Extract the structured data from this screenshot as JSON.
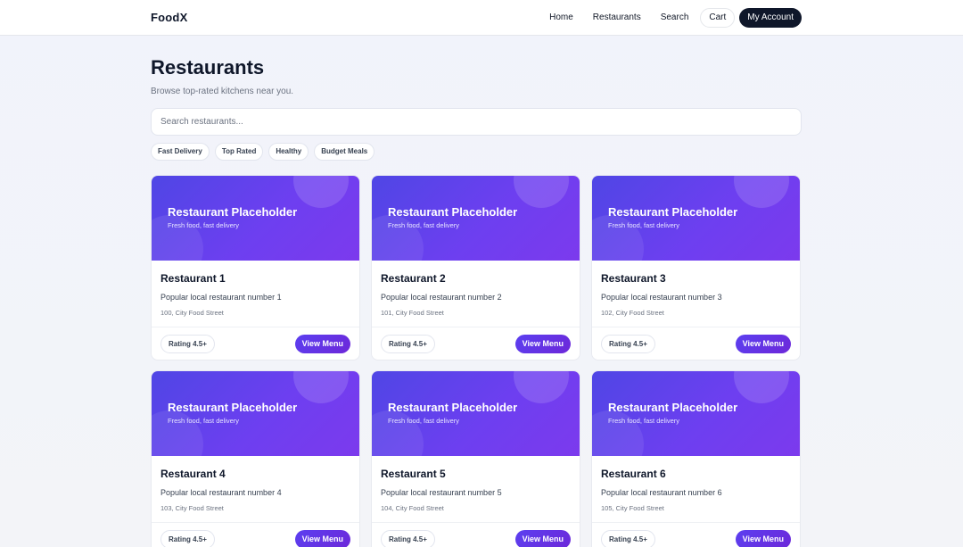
{
  "header": {
    "brand": "FoodX",
    "nav": [
      "Home",
      "Restaurants",
      "Search"
    ],
    "cart_label": "Cart",
    "account_label": "My Account"
  },
  "page": {
    "title": "Restaurants",
    "subtitle": "Browse top-rated kitchens near you."
  },
  "search": {
    "placeholder": "Search restaurants..."
  },
  "filters": [
    "Fast Delivery",
    "Top Rated",
    "Healthy",
    "Budget Meals"
  ],
  "restaurants": [
    {
      "banner_title": "Restaurant Placeholder",
      "banner_subtitle": "Fresh food, fast delivery",
      "name": "Restaurant 1",
      "description": "Popular local restaurant number 1",
      "address": "100, City Food Street",
      "rating": "Rating 4.5+",
      "action": "View Menu"
    },
    {
      "banner_title": "Restaurant Placeholder",
      "banner_subtitle": "Fresh food, fast delivery",
      "name": "Restaurant 2",
      "description": "Popular local restaurant number 2",
      "address": "101, City Food Street",
      "rating": "Rating 4.5+",
      "action": "View Menu"
    },
    {
      "banner_title": "Restaurant Placeholder",
      "banner_subtitle": "Fresh food, fast delivery",
      "name": "Restaurant 3",
      "description": "Popular local restaurant number 3",
      "address": "102, City Food Street",
      "rating": "Rating 4.5+",
      "action": "View Menu"
    },
    {
      "banner_title": "Restaurant Placeholder",
      "banner_subtitle": "Fresh food, fast delivery",
      "name": "Restaurant 4",
      "description": "Popular local restaurant number 4",
      "address": "103, City Food Street",
      "rating": "Rating 4.5+",
      "action": "View Menu"
    },
    {
      "banner_title": "Restaurant Placeholder",
      "banner_subtitle": "Fresh food, fast delivery",
      "name": "Restaurant 5",
      "description": "Popular local restaurant number 5",
      "address": "104, City Food Street",
      "rating": "Rating 4.5+",
      "action": "View Menu"
    },
    {
      "banner_title": "Restaurant Placeholder",
      "banner_subtitle": "Fresh food, fast delivery",
      "name": "Restaurant 6",
      "description": "Popular local restaurant number 6",
      "address": "105, City Food Street",
      "rating": "Rating 4.5+",
      "action": "View Menu"
    }
  ],
  "colors": {
    "accent": "#6d3ff0",
    "dark": "#0f172a",
    "background": "#f1f3fb"
  }
}
